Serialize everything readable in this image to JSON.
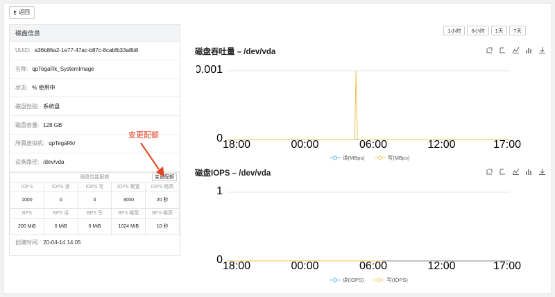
{
  "back": {
    "label": "返回"
  },
  "panel": {
    "title": "磁盘信息",
    "rows": [
      {
        "key": "UUID:",
        "value": "a36b86a2-1e77-47ac-b87c-8cabfb33a8b8"
      },
      {
        "key": "名称:",
        "value": "qpTegaRk_SystemImage"
      },
      {
        "key": "状态:",
        "value": "使用中"
      },
      {
        "key": "磁盘性别:",
        "value": "系统盘"
      },
      {
        "key": "磁盘容量:",
        "value": "128 GB"
      },
      {
        "key": "所属虚拟机:",
        "value": "qpTegaRk/"
      },
      {
        "key": "设备路径:",
        "value": "/dev/vda"
      }
    ],
    "qos": {
      "caption": "磁盘性能配额",
      "change_label": "变更配额",
      "iops_headers": [
        "IOPS",
        "IOPS 读",
        "IOPS 写",
        "IOPS 稀宽",
        "IOPS 稀高"
      ],
      "iops_values": [
        "1000",
        "0",
        "0",
        "3000",
        "20 秒"
      ],
      "bps_headers": [
        "BPS",
        "BPS 读",
        "BPS 写",
        "BPS 稀宽",
        "BPS 稀高"
      ],
      "bps_values": [
        "200 MiB",
        "0 MiB",
        "0 MiB",
        "1024 MiB",
        "10 秒"
      ]
    },
    "created": {
      "key": "创建时间:",
      "value": "20-04-14 14:05"
    }
  },
  "annotation": {
    "text": "变更配额",
    "color": "#e5421e"
  },
  "time_range": [
    "1小时",
    "6小时",
    "1天",
    "7天"
  ],
  "colors": {
    "read": "#5aaee0",
    "write": "#f0c050",
    "status": "#2ba84a"
  },
  "icons": [
    "zoom-icon",
    "zoom-reset-icon",
    "line-icon",
    "bar-icon",
    "download-icon"
  ],
  "chart_data": [
    {
      "type": "line",
      "title": "磁盘吞吐量 – /dev/vda",
      "x_ticks": [
        "18:00",
        "00:00",
        "06:00",
        "12:00",
        "17:00"
      ],
      "y_ticks": [
        "0.001",
        "0"
      ],
      "ylim": [
        0,
        0.001
      ],
      "series": [
        {
          "name": "读(MBps)",
          "values": [
            0,
            0,
            0,
            0,
            0,
            0,
            0,
            0
          ]
        },
        {
          "name": "写(MBps)",
          "values": [
            0,
            0,
            0,
            0,
            0.001,
            0,
            0,
            0
          ]
        }
      ],
      "spike_at": 0.4
    },
    {
      "type": "line",
      "title": "磁盘IOPS – /dev/vda",
      "x_ticks": [
        "18:00",
        "00:00",
        "06:00",
        "12:00",
        "17:00"
      ],
      "y_ticks": [
        "1",
        "0"
      ],
      "ylim": [
        0,
        1
      ],
      "series": [
        {
          "name": "读(IOPS)",
          "values": [
            0,
            0,
            0,
            0,
            0,
            0
          ]
        },
        {
          "name": "写(IOPS)",
          "values": [
            0,
            0,
            0,
            0,
            0,
            0
          ]
        }
      ]
    }
  ]
}
